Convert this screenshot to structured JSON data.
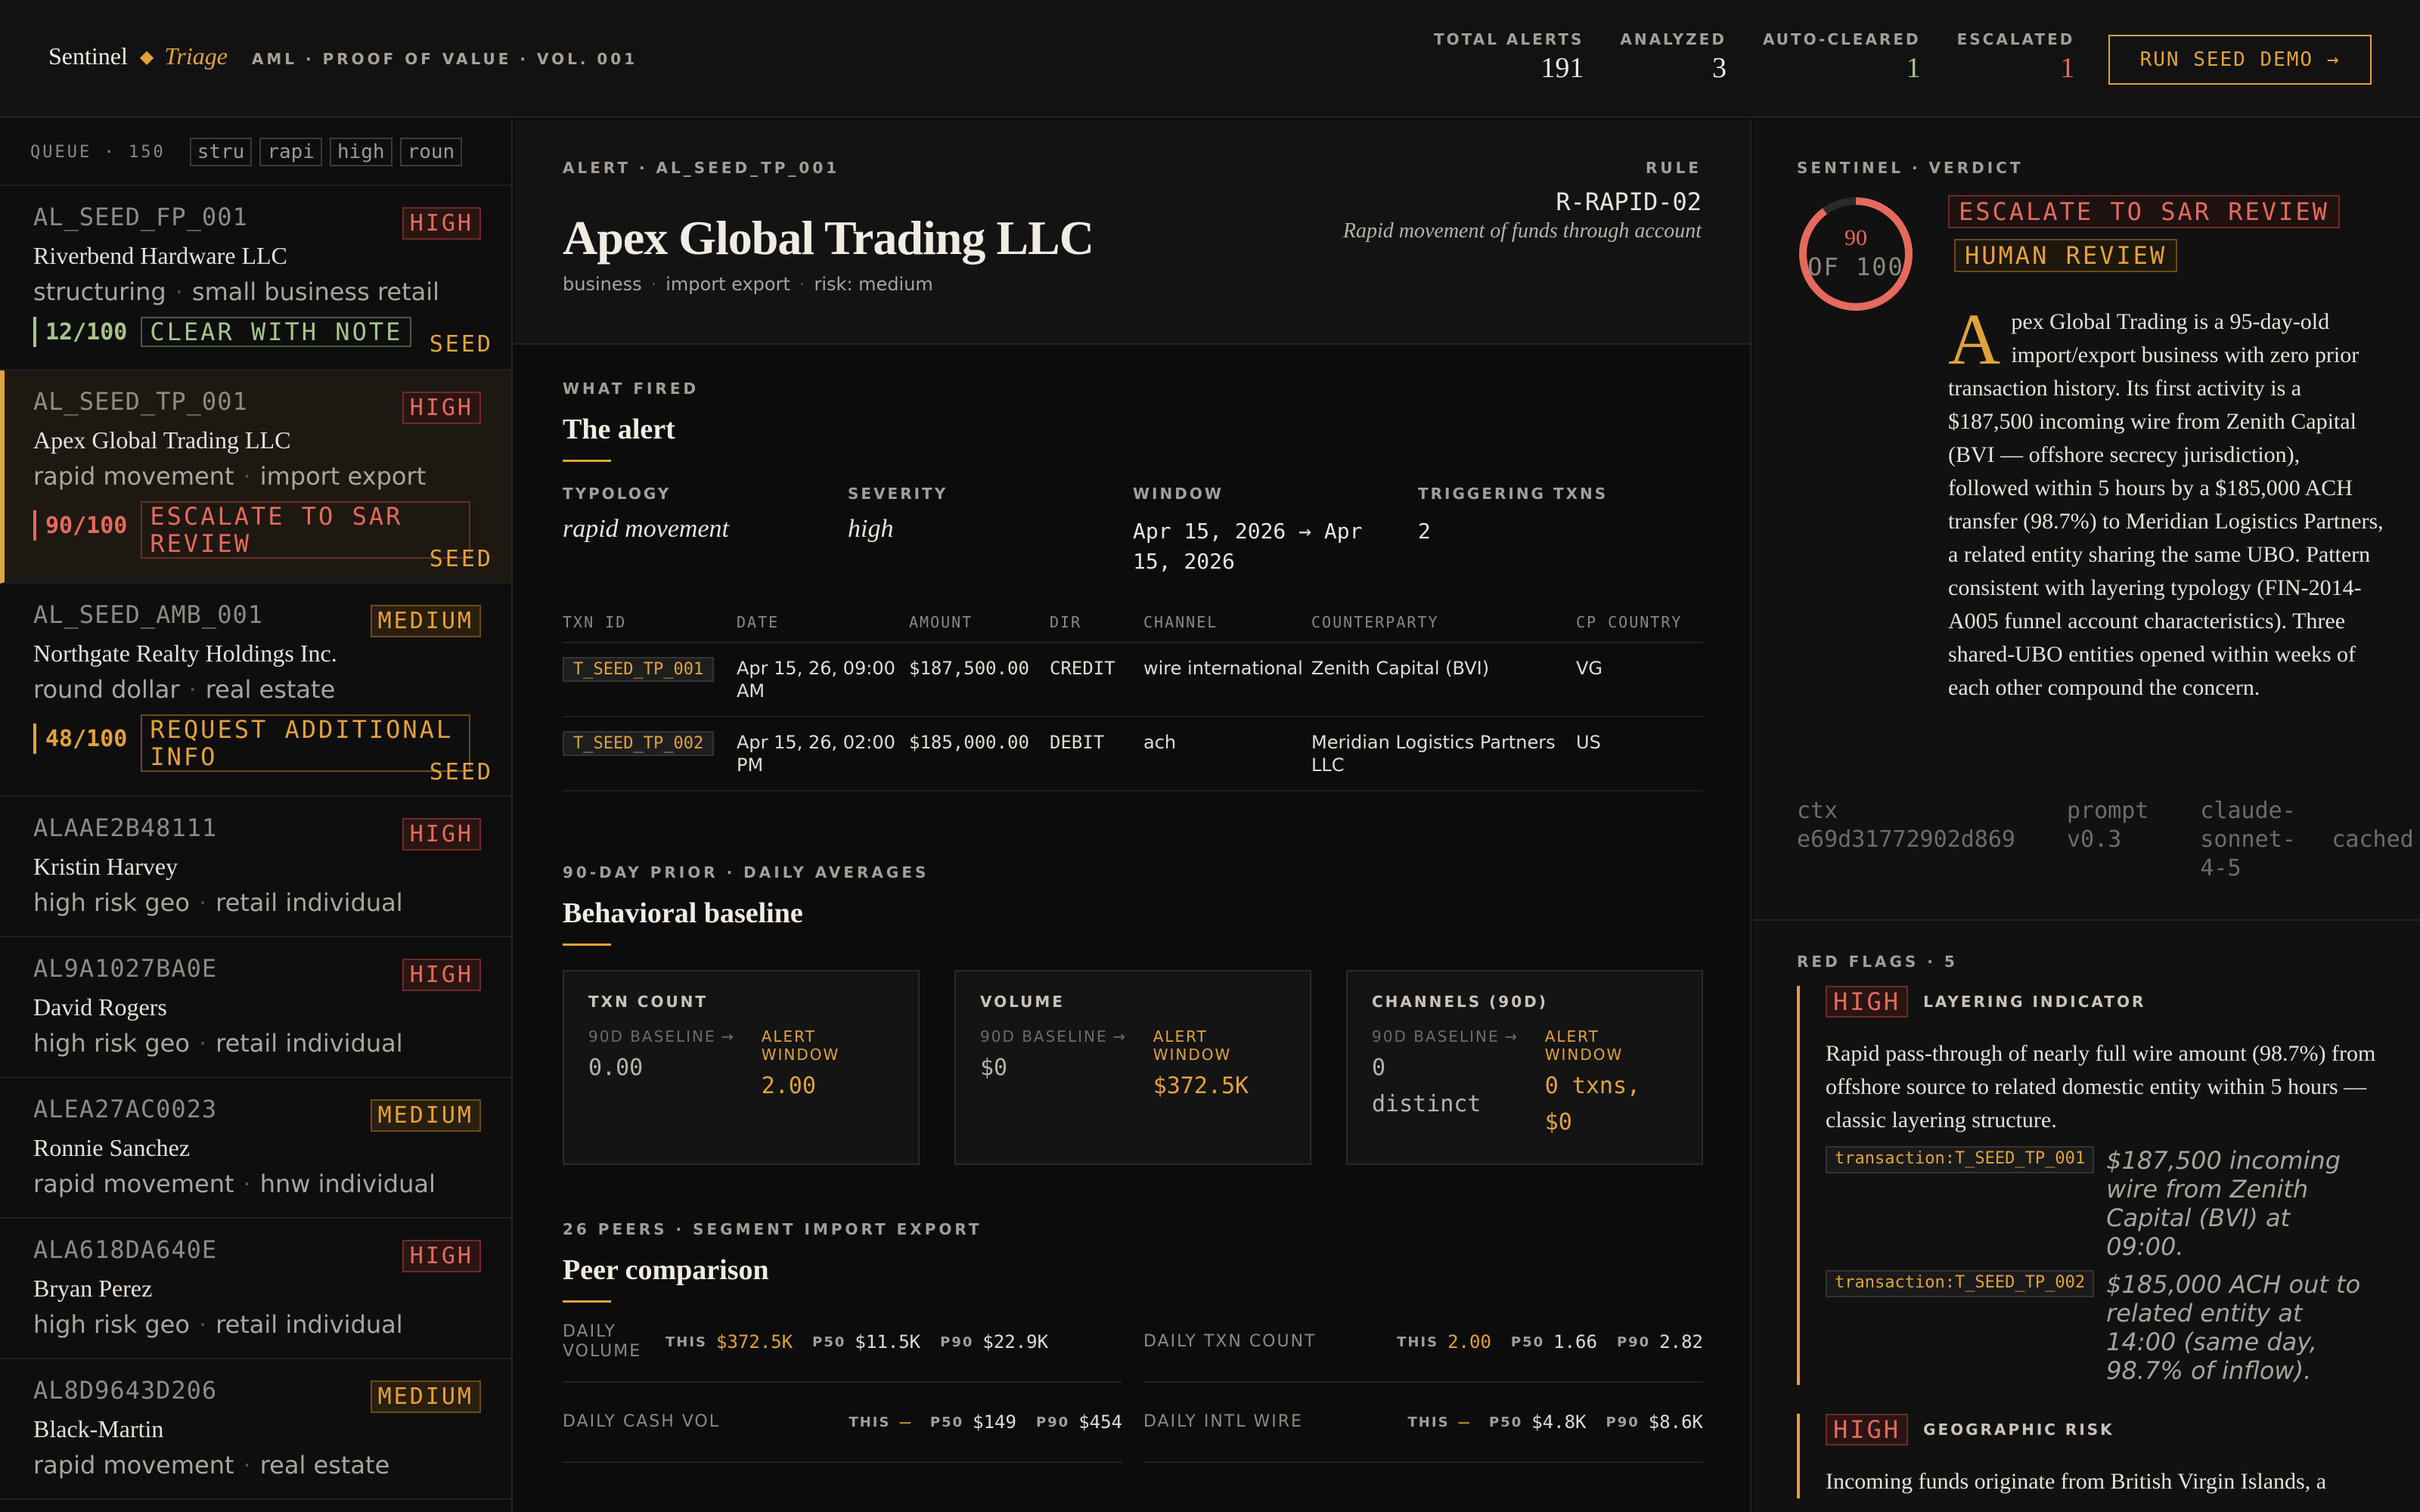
{
  "brand": {
    "name": "Sentinel",
    "sub": "Triage",
    "tagline": "AML · PROOF OF VALUE · VOL. 001"
  },
  "stats": [
    {
      "label": "TOTAL ALERTS",
      "value": "191",
      "color": "#ede8df"
    },
    {
      "label": "ANALYZED",
      "value": "3",
      "color": "#ede8df"
    },
    {
      "label": "AUTO-CLEARED",
      "value": "1",
      "color": "#a6c48a"
    },
    {
      "label": "ESCALATED",
      "value": "1",
      "color": "#e66a5c"
    }
  ],
  "run_button": "RUN SEED DEMO →",
  "queue": {
    "title": "QUEUE · 150",
    "filters": [
      "stru",
      "rapi",
      "high",
      "roun"
    ],
    "items": [
      {
        "id": "AL_SEED_FP_001",
        "severity": "HIGH",
        "name": "Riverbend Hardware LLC",
        "tag1": "structuring",
        "tag2": "small business retail",
        "score": "12/100",
        "verdict": "CLEAR WITH NOTE",
        "seed": "SEED"
      },
      {
        "id": "AL_SEED_TP_001",
        "severity": "HIGH",
        "name": "Apex Global Trading LLC",
        "tag1": "rapid movement",
        "tag2": "import export",
        "score": "90/100",
        "verdict": "ESCALATE TO SAR REVIEW",
        "seed": "SEED"
      },
      {
        "id": "AL_SEED_AMB_001",
        "severity": "MEDIUM",
        "name": "Northgate Realty Holdings Inc.",
        "tag1": "round dollar",
        "tag2": "real estate",
        "score": "48/100",
        "verdict": "REQUEST ADDITIONAL INFO",
        "seed": "SEED"
      },
      {
        "id": "ALAAE2B48111",
        "severity": "HIGH",
        "name": "Kristin Harvey",
        "tag1": "high risk geo",
        "tag2": "retail individual"
      },
      {
        "id": "AL9A1027BA0E",
        "severity": "HIGH",
        "name": "David Rogers",
        "tag1": "high risk geo",
        "tag2": "retail individual"
      },
      {
        "id": "ALEA27AC0023",
        "severity": "MEDIUM",
        "name": "Ronnie Sanchez",
        "tag1": "rapid movement",
        "tag2": "hnw individual"
      },
      {
        "id": "ALA618DA640E",
        "severity": "HIGH",
        "name": "Bryan Perez",
        "tag1": "high risk geo",
        "tag2": "retail individual"
      },
      {
        "id": "AL8D9643D206",
        "severity": "MEDIUM",
        "name": "Black-Martin",
        "tag1": "rapid movement",
        "tag2": "real estate"
      }
    ]
  },
  "alert": {
    "eyebrow": "ALERT · AL_SEED_TP_001",
    "title": "Apex Global Trading LLC",
    "meta": [
      "business",
      "import export",
      "risk: medium"
    ],
    "rule_label": "RULE",
    "rule_code": "R-RAPID-02",
    "rule_desc": "Rapid movement of funds through account"
  },
  "what_fired": {
    "eyebrow": "WHAT FIRED",
    "title": "The alert",
    "facts": [
      {
        "label": "TYPOLOGY",
        "value": "rapid movement"
      },
      {
        "label": "SEVERITY",
        "value": "high"
      },
      {
        "label": "WINDOW",
        "value": "Apr 15, 2026 → Apr 15, 2026"
      },
      {
        "label": "TRIGGERING TXNS",
        "value": "2"
      }
    ],
    "columns": [
      "TXN ID",
      "DATE",
      "AMOUNT",
      "DIR",
      "CHANNEL",
      "COUNTERPARTY",
      "CP COUNTRY"
    ],
    "rows": [
      {
        "id": "T_SEED_TP_001",
        "date": "Apr 15, 26, 09:00 AM",
        "amount": "$187,500.00",
        "dir": "CREDIT",
        "channel": "wire international",
        "counterparty": "Zenith Capital (BVI)",
        "country": "VG"
      },
      {
        "id": "T_SEED_TP_002",
        "date": "Apr 15, 26, 02:00 PM",
        "amount": "$185,000.00",
        "dir": "DEBIT",
        "channel": "ach",
        "counterparty": "Meridian Logistics Partners LLC",
        "country": "US"
      }
    ]
  },
  "baseline": {
    "eyebrow": "90-DAY PRIOR · DAILY AVERAGES",
    "title": "Behavioral baseline",
    "base_label": "90D BASELINE",
    "arrow": "→",
    "window_label": "ALERT WINDOW",
    "cards": [
      {
        "title": "TXN COUNT",
        "baseline": "0.00",
        "window": "2.00"
      },
      {
        "title": "VOLUME",
        "baseline": "$0",
        "window": "$372.5K"
      },
      {
        "title": "CHANNELS (90D)",
        "baseline": "0 distinct",
        "window": "0 txns, $0"
      }
    ]
  },
  "peers": {
    "eyebrow": "26 PEERS · SEGMENT IMPORT EXPORT",
    "title": "Peer comparison",
    "k_this": "THIS",
    "k_p50": "P50",
    "k_p90": "P90",
    "rows": [
      {
        "label": "DAILY VOLUME",
        "this": "$372.5K",
        "p50": "$11.5K",
        "p90": "$22.9K"
      },
      {
        "label": "DAILY TXN COUNT",
        "this": "2.00",
        "p50": "1.66",
        "p90": "2.82"
      },
      {
        "label": "DAILY CASH VOL",
        "this": "—",
        "p50": "$149",
        "p90": "$454"
      },
      {
        "label": "DAILY INTL WIRE",
        "this": "—",
        "p50": "$4.8K",
        "p90": "$8.6K"
      }
    ]
  },
  "verdict": {
    "eyebrow": "SENTINEL · VERDICT",
    "score": 90,
    "score_max": 100,
    "score_of": "OF 100",
    "decision": "ESCALATE TO SAR REVIEW",
    "review": "HUMAN REVIEW",
    "dropcap": "A",
    "summary": "pex Global Trading is a 95-day-old import/export business with zero prior transaction history. Its first activity is a $187,500 incoming wire from Zenith Capital (BVI — offshore secrecy jurisdiction), followed within 5 hours by a $185,000 ACH transfer (98.7%) to Meridian Logistics Partners, a related entity sharing the same UBO. Pattern consistent with layering typology (FIN-2014-A005 funnel account characteristics). Three shared-UBO entities opened within weeks of each other compound the concern.",
    "ctx_label": "ctx",
    "ctx": "e69d31772902d869",
    "prompt_label": "prompt",
    "prompt": "v0.3",
    "model": "claude-sonnet-4-5",
    "cache": "cached"
  },
  "red_flags": {
    "eyebrow": "RED FLAGS · 5",
    "items": [
      {
        "severity": "HIGH",
        "type": "LAYERING INDICATOR",
        "text": "Rapid pass-through of nearly full wire amount (98.7%) from offshore source to related domestic entity within 5 hours — classic layering structure.",
        "evidence": [
          {
            "ref": "transaction:T_SEED_TP_001",
            "quote": "$187,500 incoming wire from Zenith Capital (BVI) at 09:00."
          },
          {
            "ref": "transaction:T_SEED_TP_002",
            "quote": "$185,000 ACH out to related entity at 14:00 (same day, 98.7% of inflow)."
          }
        ]
      },
      {
        "severity": "HIGH",
        "type": "GEOGRAPHIC RISK",
        "text": "Incoming funds originate from British Virgin Islands, a",
        "evidence": []
      }
    ]
  },
  "colors": {
    "accent": "#e0a33a",
    "danger": "#e66a5c",
    "success": "#a6c48a",
    "background": "#0c0c0d"
  }
}
